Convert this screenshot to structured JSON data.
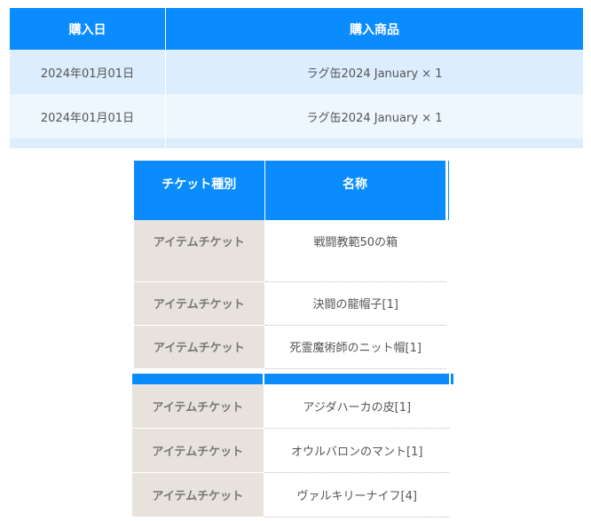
{
  "purchase_table": {
    "headers": {
      "date": "購入日",
      "item": "購入商品"
    },
    "rows": [
      {
        "date": "2024年01月01日",
        "item": "ラグ缶2024 January × 1"
      },
      {
        "date": "2024年01月01日",
        "item": "ラグ缶2024 January × 1"
      }
    ]
  },
  "ticket_table_1": {
    "headers": {
      "kind": "チケット種別",
      "name": "名称"
    },
    "rows": [
      {
        "kind": "アイテムチケット",
        "name": "戦闘教範50の箱"
      },
      {
        "kind": "アイテムチケット",
        "name": "決闘の龍帽子[1]"
      },
      {
        "kind": "アイテムチケット",
        "name": "死霊魔術師のニット帽[1]"
      }
    ]
  },
  "ticket_table_2": {
    "rows": [
      {
        "kind": "アイテムチケット",
        "name": "アジダハーカの皮[1]"
      },
      {
        "kind": "アイテムチケット",
        "name": "オウルバロンのマント[1]"
      },
      {
        "kind": "アイテムチケット",
        "name": "ヴァルキリーナイフ[4]"
      }
    ]
  },
  "colors": {
    "header_blue": "#0a8cff",
    "row_light_blue": "#dcedfd",
    "row_lighter_blue": "#eef6fe",
    "kind_cell_beige": "#e8e2dc"
  }
}
